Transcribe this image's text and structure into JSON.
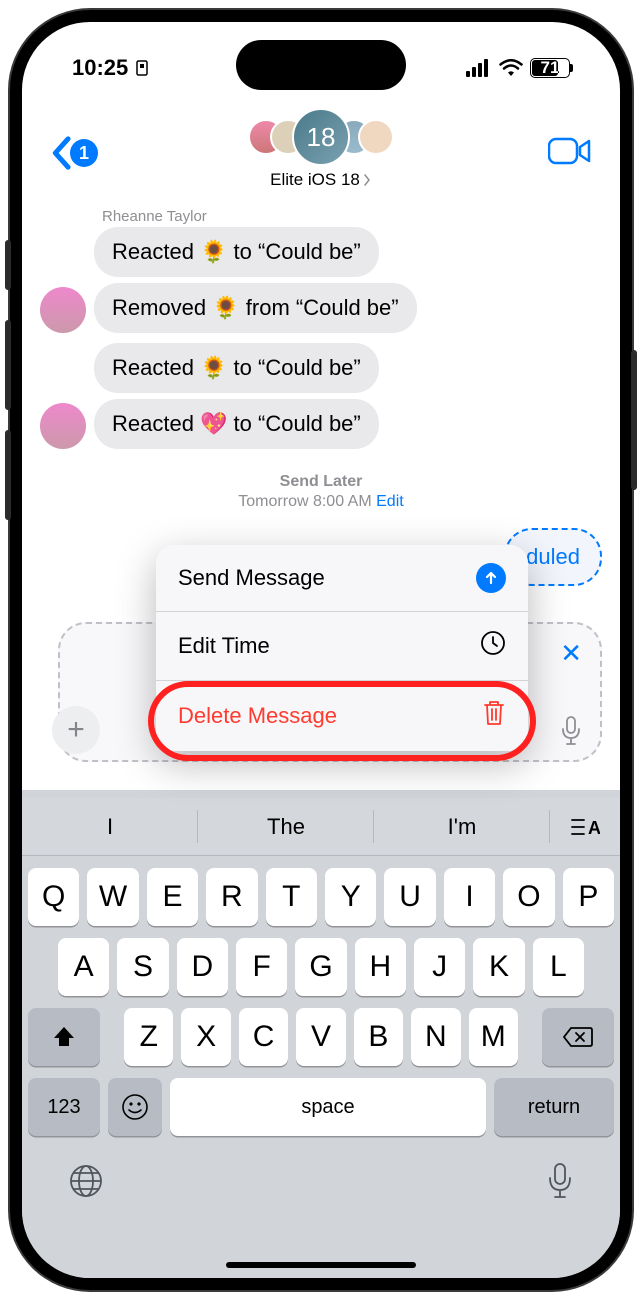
{
  "status": {
    "time": "10:25",
    "battery_pct": "71",
    "battery_fill_pct": 71
  },
  "nav": {
    "unread": "1",
    "group_name": "Elite iOS 18",
    "big_avatar_text": "18"
  },
  "thread": {
    "sender": "Rheanne Taylor",
    "messages": [
      "Reacted 🌻 to “Could be”",
      "Removed 🌻 from “Could be”",
      "Reacted 🌻 to “Could be”",
      "Reacted 💖 to “Could be”"
    ]
  },
  "send_later": {
    "title": "Send Later",
    "subtitle": "Tomorrow 8:00 AM",
    "edit": "Edit",
    "scheduled_fragment": "duled"
  },
  "menu": {
    "send": "Send Message",
    "edit_time": "Edit Time",
    "delete": "Delete Message"
  },
  "input": {
    "close": "✕",
    "plus": "+"
  },
  "keyboard": {
    "suggestions": [
      "I",
      "The",
      "I'm"
    ],
    "row1": [
      "Q",
      "W",
      "E",
      "R",
      "T",
      "Y",
      "U",
      "I",
      "O",
      "P"
    ],
    "row2": [
      "A",
      "S",
      "D",
      "F",
      "G",
      "H",
      "J",
      "K",
      "L"
    ],
    "row3": [
      "Z",
      "X",
      "C",
      "V",
      "B",
      "N",
      "M"
    ],
    "numkey": "123",
    "space": "space",
    "return": "return"
  }
}
